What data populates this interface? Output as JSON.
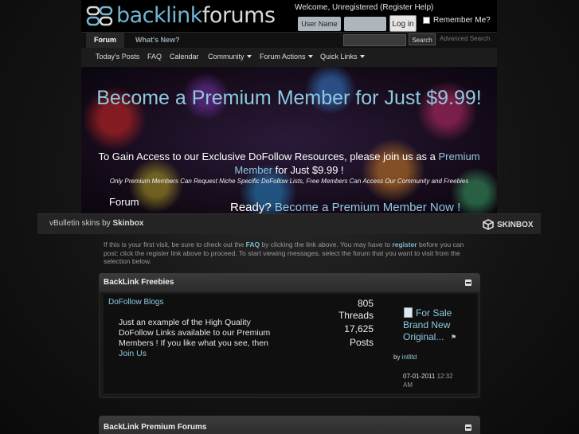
{
  "header": {
    "logo_part1": "backlink",
    "logo_part2": "forums",
    "welcome_prefix": "Welcome, Unregistered (",
    "register_link": "Register",
    "help_link": "Help",
    "welcome_suffix": ")",
    "username_label": "User Name",
    "login_button": "Log in",
    "remember_me": "Remember Me?"
  },
  "nav": {
    "tab_forum": "Forum",
    "tab_whats_new": "What's New?",
    "search_button": "Search",
    "advanced_search": "Advanced Search",
    "subnav": {
      "todays_posts": "Today's Posts",
      "faq": "FAQ",
      "calendar": "Calendar",
      "community": "Community",
      "forum_actions": "Forum Actions",
      "quick_links": "Quick Links"
    }
  },
  "banner": {
    "title": "Become a Premium Member for Just $9.99!",
    "line2_prefix": "To Gain Access to our Exclusive DoFollow Resources, please join us as a",
    "line2_highlight": "Premium Member",
    "line2_suffix": "for Just $9.99 !",
    "small_text": "Only Premium Members Can Request Niche Specific DoFollow Lists, Free Members Can Access Our Community and Freebies",
    "forum_label": "Forum",
    "ready_prefix": "Ready?",
    "ready_link": "Become a Premium Member Now !"
  },
  "skin": {
    "prefix": "vBulletin skins by",
    "brand": "Skinbox",
    "logo_text": "SKINBOX"
  },
  "notice": {
    "part1": "If this is your first visit, be sure to check out the",
    "faq": "FAQ",
    "part2": "by clicking the link above. You may have to",
    "register": "register",
    "part3": "before you can post: click the register link above to proceed. To start viewing messages, select the forum that you want to visit from the selection below."
  },
  "forum_block_1": {
    "title": "BackLink Freebies",
    "forum_name": "DoFollow Blogs",
    "description": "Just an example of the High Quality DoFollow Links available to our Premium Members ! If you like what you see, then",
    "description_link": "Join Us",
    "threads_count": "805",
    "threads_label": "Threads",
    "posts_count": "17,625",
    "posts_label": "Posts",
    "last_post_title": "For Sale Brand New Original...",
    "last_post_by_prefix": "by",
    "last_post_by_user": "intlltd",
    "last_post_date": "07-01-2011",
    "last_post_time": "12:32 AM"
  },
  "forum_block_2": {
    "title": "BackLink Premium Forums"
  },
  "colors": {
    "accent": "#8ec9e0",
    "background": "#141414"
  }
}
